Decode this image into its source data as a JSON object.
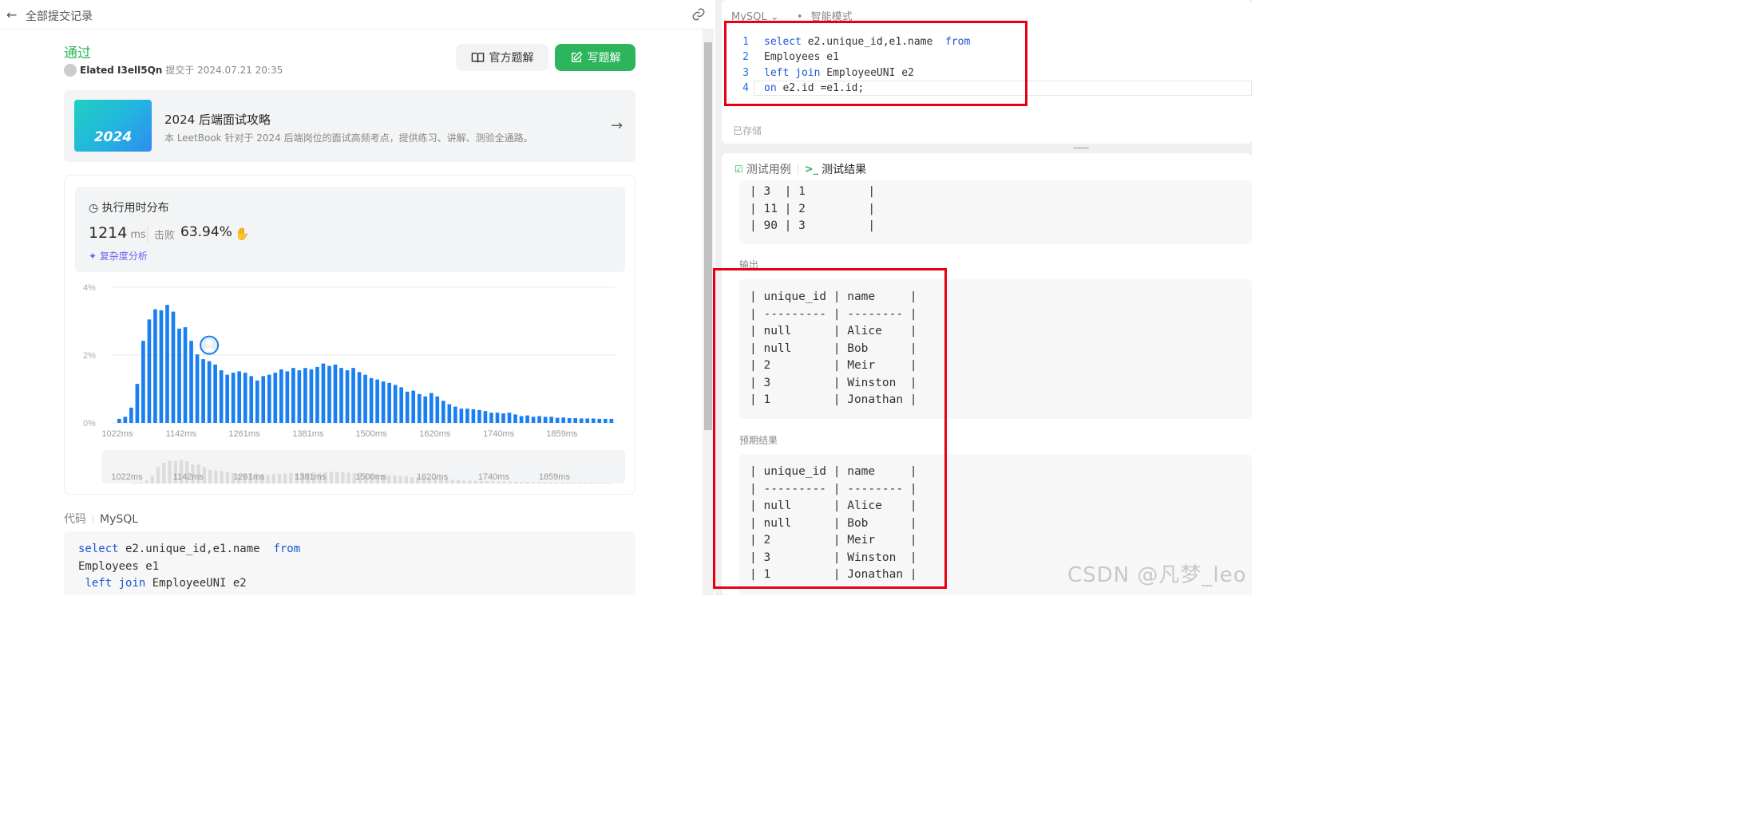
{
  "topbar": {
    "back_label": "←",
    "title": "全部提交记录"
  },
  "submission": {
    "status": "通过",
    "user": "Elated I3ell5Qn",
    "submitted_text": "提交于 2024.07.21 20:35"
  },
  "buttons": {
    "official": "官方题解",
    "write": "写题解"
  },
  "banner": {
    "image_text": "2024",
    "title": "2024 后端面试攻略",
    "desc": "本 LeetBook 针对于 2024 后端岗位的面试高频考点，提供练习、讲解、测验全通路。"
  },
  "stats": {
    "title": "执行用时分布",
    "runtime": "1214",
    "runtime_unit": "ms",
    "beats_label": "击败",
    "beats_value": "63.94%",
    "complexity": "复杂度分析"
  },
  "chart_data": {
    "type": "bar",
    "title": "",
    "xlabel": "",
    "ylabel": "",
    "ylim": [
      0,
      4
    ],
    "y_ticks": [
      "0%",
      "2%",
      "4%"
    ],
    "x_ticks": [
      "1022ms",
      "1142ms",
      "1261ms",
      "1381ms",
      "1500ms",
      "1620ms",
      "1740ms",
      "1859ms"
    ],
    "x_range_ms": [
      1022,
      1960
    ],
    "bar_color": "#1a7ff0",
    "values": [
      0.12,
      0.18,
      0.45,
      1.15,
      2.42,
      3.05,
      3.35,
      3.32,
      3.48,
      3.28,
      2.78,
      2.82,
      2.42,
      2.02,
      1.88,
      1.82,
      1.72,
      1.55,
      1.42,
      1.48,
      1.52,
      1.48,
      1.38,
      1.25,
      1.38,
      1.42,
      1.48,
      1.58,
      1.52,
      1.62,
      1.55,
      1.62,
      1.58,
      1.65,
      1.75,
      1.68,
      1.72,
      1.62,
      1.55,
      1.62,
      1.5,
      1.42,
      1.32,
      1.28,
      1.22,
      1.18,
      1.12,
      1.05,
      0.92,
      0.95,
      0.85,
      0.78,
      0.88,
      0.78,
      0.65,
      0.55,
      0.48,
      0.42,
      0.42,
      0.4,
      0.38,
      0.35,
      0.3,
      0.3,
      0.28,
      0.3,
      0.25,
      0.2,
      0.22,
      0.18,
      0.2,
      0.18,
      0.18,
      0.15,
      0.16,
      0.14,
      0.14,
      0.13,
      0.13,
      0.13,
      0.12,
      0.12,
      0.12
    ],
    "marker_index": 15
  },
  "code_section": {
    "label": "代码",
    "lang": "MySQL",
    "lines": [
      [
        {
          "t": "select",
          "k": true
        },
        {
          "t": " e2.unique_id,e1.name  ",
          "k": false
        },
        {
          "t": "from",
          "k": true
        }
      ],
      [
        {
          "t": "Employees e1",
          "k": false
        }
      ],
      [
        {
          "t": " ",
          "k": false
        },
        {
          "t": "left join",
          "k": true
        },
        {
          "t": " EmployeeUNI e2",
          "k": false
        }
      ]
    ]
  },
  "editor": {
    "lang": "MySQL",
    "mode": "智能模式",
    "saved": "已存储",
    "lines": [
      {
        "n": "1",
        "parts": [
          {
            "t": "select",
            "k": true
          },
          {
            "t": " e2.unique_id,e1.name  ",
            "k": false
          },
          {
            "t": "from",
            "k": true
          }
        ]
      },
      {
        "n": "2",
        "parts": [
          {
            "t": "Employees e1",
            "k": false
          }
        ]
      },
      {
        "n": "3",
        "parts": [
          {
            "t": "left join",
            "k": true
          },
          {
            "t": " EmployeeUNI e2",
            "k": false
          }
        ]
      },
      {
        "n": "4",
        "parts": [
          {
            "t": "on",
            "k": true
          },
          {
            "t": " e2.id =e1.id;",
            "k": false
          }
        ]
      }
    ]
  },
  "results": {
    "tab_testcase": "测试用例",
    "tab_result": "测试结果",
    "input_tail": [
      "| 3  | 1         |",
      "| 11 | 2         |",
      "| 90 | 3         |"
    ],
    "output_label": "输出",
    "output": [
      "| unique_id | name     |",
      "| --------- | -------- |",
      "| null      | Alice    |",
      "| null      | Bob      |",
      "| 2         | Meir     |",
      "| 3         | Winston  |",
      "| 1         | Jonathan |"
    ],
    "expected_label": "预期结果",
    "expected": [
      "| unique_id | name     |",
      "| --------- | -------- |",
      "| null      | Alice    |",
      "| null      | Bob      |",
      "| 2         | Meir     |",
      "| 3         | Winston  |",
      "| 1         | Jonathan |"
    ]
  },
  "watermark": "CSDN @凡梦_leo",
  "colors": {
    "accent_green": "#2db55d",
    "keyword_blue": "#1d55d8",
    "highlight_red": "#e60012"
  }
}
